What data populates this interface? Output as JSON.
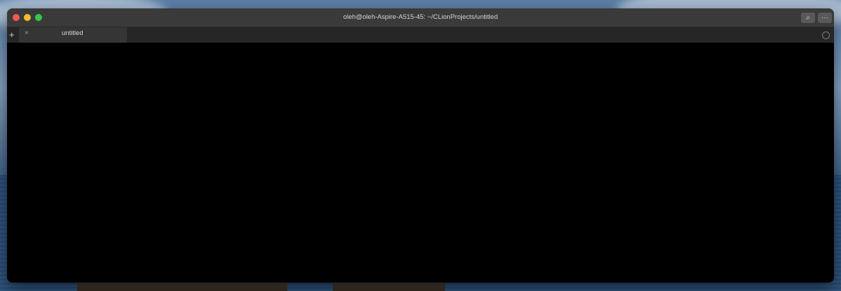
{
  "window": {
    "title": "oleh@oleh-Aspire-A515-45: ~/CLionProjects/untitled",
    "search_icon": "⌕",
    "more_icon": "···"
  },
  "tabs": [
    {
      "label": "untitled",
      "close_icon": "×"
    }
  ],
  "tabbar": {
    "new_tab_icon": "+"
  },
  "terminal": {
    "content": ""
  },
  "colors": {
    "close": "#ee5b55",
    "minimize": "#f3bb2d",
    "zoom": "#2fcb48",
    "titlebar": "#3a3a3a",
    "terminal_bg": "#000000"
  }
}
